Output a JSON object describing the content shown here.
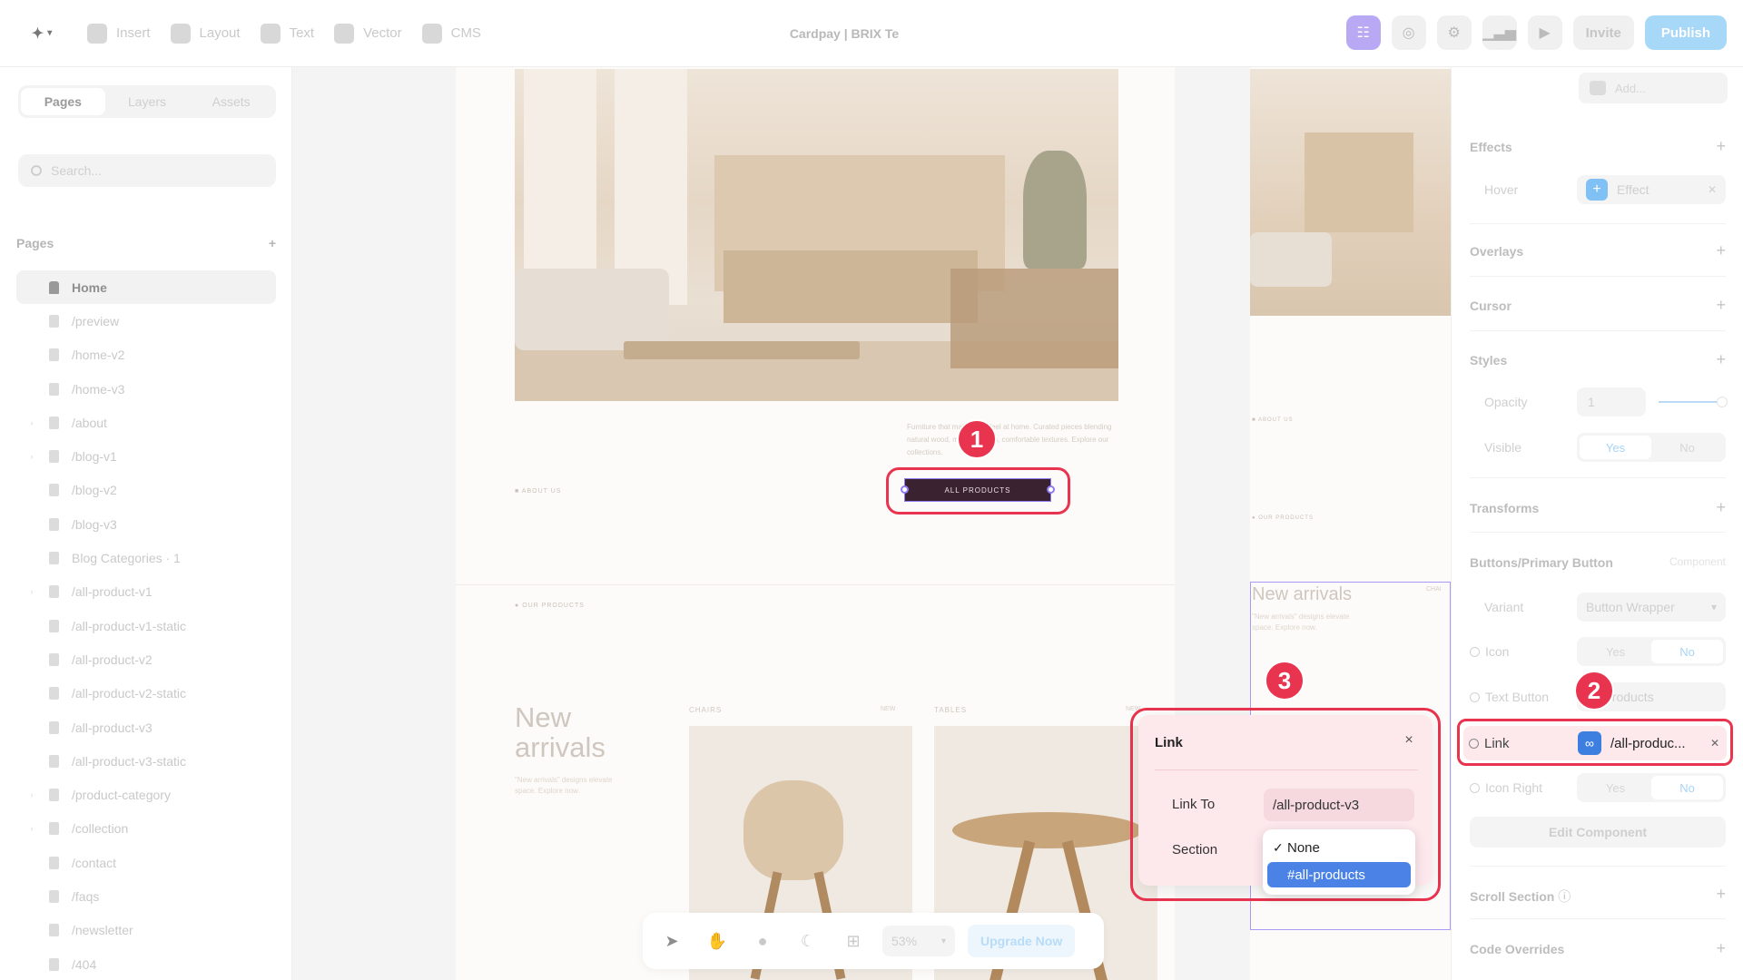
{
  "toolbar": {
    "tools": [
      {
        "label": "Insert",
        "icon": "insert-icon"
      },
      {
        "label": "Layout",
        "icon": "layout-icon"
      },
      {
        "label": "Text",
        "icon": "text-icon"
      },
      {
        "label": "Vector",
        "icon": "vector-icon"
      },
      {
        "label": "CMS",
        "icon": "cms-icon"
      }
    ],
    "doc_title": "Cardpay | BRIX Te",
    "invite_label": "Invite",
    "publish_label": "Publish"
  },
  "sidebar": {
    "tabs": [
      "Pages",
      "Layers",
      "Assets"
    ],
    "search_placeholder": "Search...",
    "pages_heading": "Pages",
    "add_icon": "+",
    "pages": [
      {
        "label": "Home",
        "caret": false
      },
      {
        "label": "/preview",
        "caret": false
      },
      {
        "label": "/home-v2",
        "caret": false
      },
      {
        "label": "/home-v3",
        "caret": false
      },
      {
        "label": "/about",
        "caret": true
      },
      {
        "label": "/blog-v1",
        "caret": true
      },
      {
        "label": "/blog-v2",
        "caret": false
      },
      {
        "label": "/blog-v3",
        "caret": false
      },
      {
        "label": "Blog Categories · 1",
        "caret": false
      },
      {
        "label": "/all-product-v1",
        "caret": true
      },
      {
        "label": "/all-product-v1-static",
        "caret": false
      },
      {
        "label": "/all-product-v2",
        "caret": false
      },
      {
        "label": "/all-product-v2-static",
        "caret": false
      },
      {
        "label": "/all-product-v3",
        "caret": false
      },
      {
        "label": "/all-product-v3-static",
        "caret": false
      },
      {
        "label": "/product-category",
        "caret": true
      },
      {
        "label": "/collection",
        "caret": true
      },
      {
        "label": "/contact",
        "caret": false
      },
      {
        "label": "/faqs",
        "caret": false
      },
      {
        "label": "/newsletter",
        "caret": false
      },
      {
        "label": "/404",
        "caret": false
      }
    ]
  },
  "canvas": {
    "hero_description": "Furniture that makes you feel at home. Curated pieces blending natural wood, modern styles, comfortable textures. Explore our collections.",
    "about_tag": "ABOUT US",
    "button_label": "ALL PRODUCTS",
    "our_products_tag": "OUR PRODUCTS",
    "new_arrivals": "New arrivals",
    "new_arrivals_sub": "\"New arrivals\" designs elevate space. Explore now.",
    "categories": [
      {
        "label": "CHAIRS",
        "tag": "NEW"
      },
      {
        "label": "TABLES",
        "tag": "NEW"
      }
    ],
    "side_about_tag": "ABOUT US",
    "side_products_tag": "OUR PRODUCTS",
    "side_new_arrivals": "New arrivals",
    "side_new_arrivals_sub": "\"New arrivals\" designs elevate space. Explore now.",
    "side_chairs_tag": "CHAI"
  },
  "bottom_bar": {
    "zoom": "53%",
    "upgrade_label": "Upgrade Now"
  },
  "link_popover": {
    "title": "Link",
    "close": "×",
    "link_to_label": "Link To",
    "link_to_value": "/all-product-v3",
    "section_label": "Section",
    "options": [
      "None",
      "#all-products"
    ],
    "selected_option": "None",
    "highlighted_option": "#all-products"
  },
  "right_panel": {
    "add_label": "Add...",
    "effects": "Effects",
    "hover_label": "Hover",
    "hover_value": "Effect",
    "overlays": "Overlays",
    "cursor": "Cursor",
    "styles": "Styles",
    "opacity_label": "Opacity",
    "opacity_value": "1",
    "opacity_level": 1,
    "visible_label": "Visible",
    "yes": "Yes",
    "no": "No",
    "transforms": "Transforms",
    "component_title": "Buttons/Primary Button",
    "component_tag": "Component",
    "variant_label": "Variant",
    "variant_value": "Button Wrapper",
    "icon_label": "Icon",
    "text_button_label": "Text Button",
    "text_button_value": "All Products",
    "link_label": "Link",
    "link_value": "/all-produc...",
    "icon_right_label": "Icon Right",
    "edit_component": "Edit Component",
    "scroll_section": "Scroll Section",
    "code_overrides": "Code Overrides"
  },
  "badges": [
    "1",
    "2",
    "3"
  ],
  "colors": {
    "accent_red": "#e8344f",
    "link_blue": "#3d7fe0",
    "highlight_blue": "#4b82e6",
    "button_bg": "#3b2230",
    "selection_purple": "#8f7cf2"
  }
}
